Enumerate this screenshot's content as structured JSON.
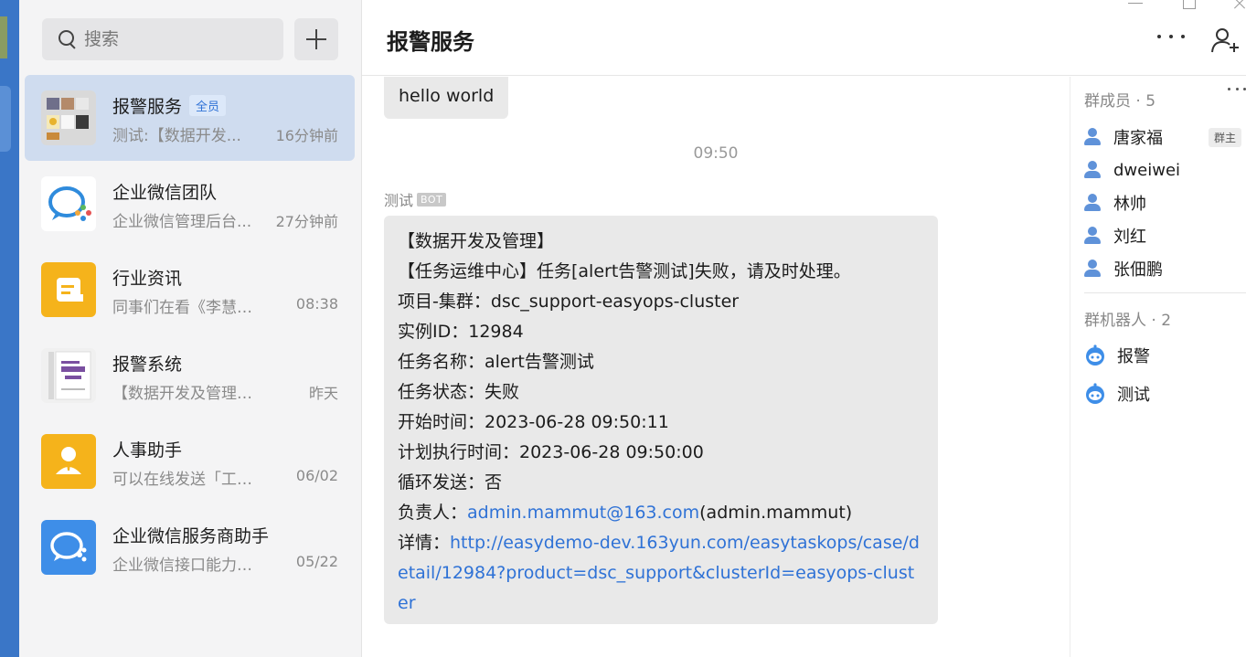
{
  "search": {
    "placeholder": "搜索"
  },
  "chats": [
    {
      "name": "报警服务",
      "tag": "全员",
      "preview": "测试:【数据开发...",
      "time": "16分钟前"
    },
    {
      "name": "企业微信团队",
      "tag": "",
      "preview": "企业微信管理后台...",
      "time": "27分钟前"
    },
    {
      "name": "行业资讯",
      "tag": "",
      "preview": "同事们在看《李慧镝...",
      "time": "08:38"
    },
    {
      "name": "报警系统",
      "tag": "",
      "preview": "【数据开发及管理】【...",
      "time": "昨天"
    },
    {
      "name": "人事助手",
      "tag": "",
      "preview": "可以在线发送「工资...",
      "time": "06/02"
    },
    {
      "name": "企业微信服务商助手",
      "tag": "",
      "preview": "企业微信接口能力升...",
      "time": "05/22"
    }
  ],
  "header": {
    "title": "报警服务"
  },
  "messages": {
    "hello": "hello world",
    "timestamp": "09:50",
    "sender": "测试",
    "sender_badge": "BOT",
    "lines": {
      "l1": "【数据开发及管理】",
      "l2": "【任务运维中心】任务[alert告警测试]失败，请及时处理。",
      "l3": "项目-集群：dsc_support-easyops-cluster",
      "l4": "实例ID：12984",
      "l5": "任务名称：alert告警测试",
      "l6": "任务状态：失败",
      "l7": "开始时间：2023-06-28 09:50:11",
      "l8": "计划执行时间：2023-06-28 09:50:00",
      "l9": "循环发送：否",
      "owner_label": "负责人：",
      "owner_email": "admin.mammut@163.com",
      "owner_suffix": "(admin.mammut)",
      "detail_label": "详情：",
      "detail_url": "http://easydemo-dev.163yun.com/easytaskops/case/detail/12984?product=dsc_support&clusterId=easyops-cluster"
    }
  },
  "members": {
    "title": "群成员 · 5",
    "list": [
      {
        "name": "唐家福",
        "badge": "群主"
      },
      {
        "name": "dweiwei"
      },
      {
        "name": "林帅"
      },
      {
        "name": "刘红"
      },
      {
        "name": "张佃鹏"
      }
    ]
  },
  "robots": {
    "title": "群机器人 · 2",
    "list": [
      {
        "name": "报警"
      },
      {
        "name": "测试"
      }
    ]
  },
  "colors": {
    "accent": "#2f72d6",
    "nav": "#3a76c7",
    "active_chat": "#cfdcef",
    "bubble": "#e9e9e9"
  }
}
